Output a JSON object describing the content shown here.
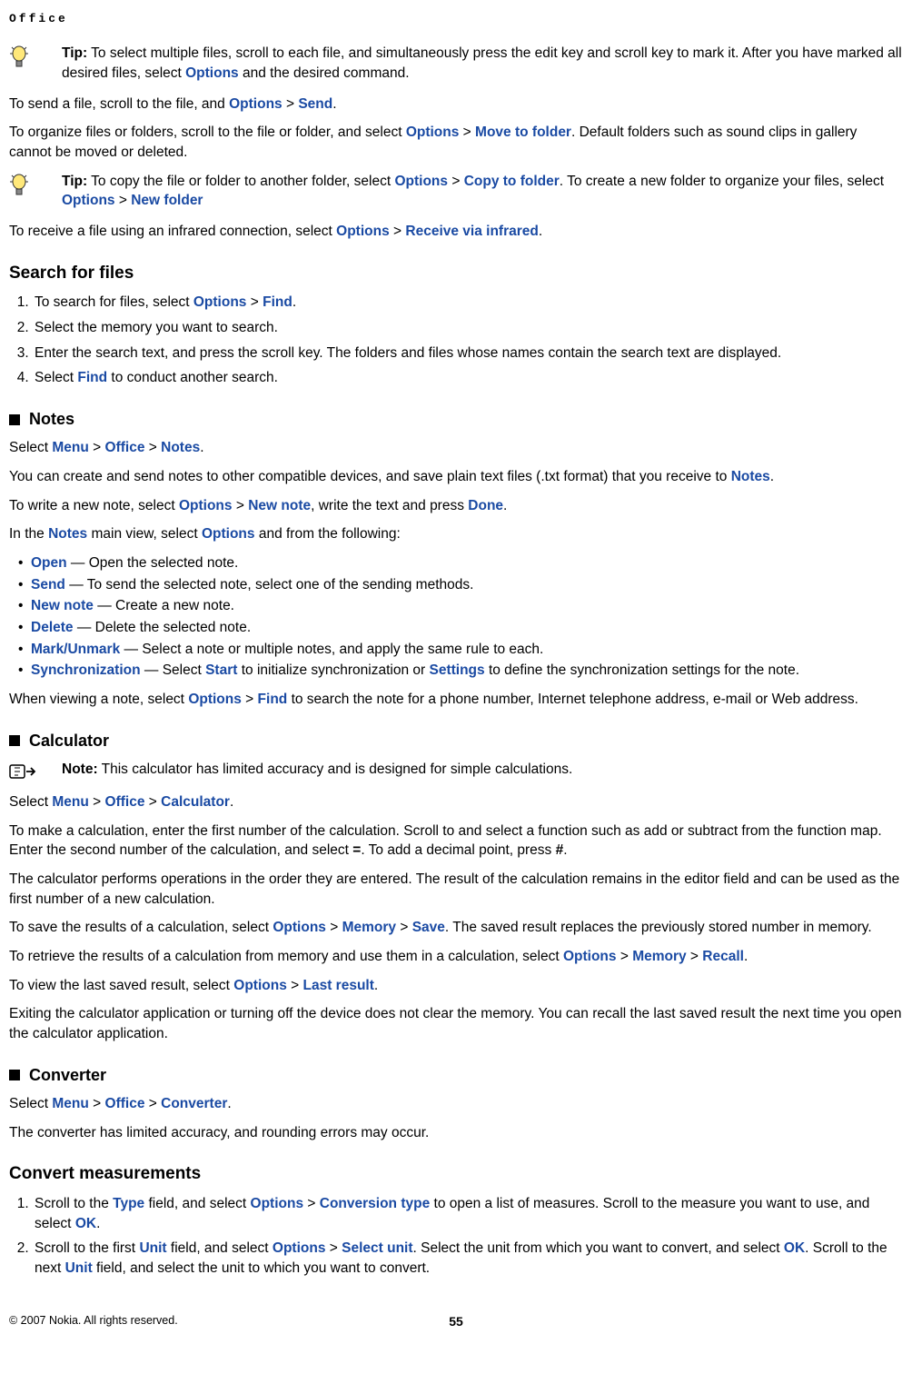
{
  "header": "Office",
  "tip1": {
    "label": "Tip:",
    "text1": " To select multiple files, scroll to each file, and simultaneously press the edit key and scroll key to mark it. After you have marked all desired files, select ",
    "options": "Options",
    "text2": " and the desired command."
  },
  "p1": {
    "t1": "To send a file, scroll to the file, and ",
    "options": "Options",
    "gt": " > ",
    "send": "Send",
    "t2": "."
  },
  "p2": {
    "t1": "To organize files or folders, scroll to the file or folder, and select ",
    "options": "Options",
    "gt": " > ",
    "move": "Move to folder",
    "t2": ". Default folders such as sound clips in gallery cannot be moved or deleted."
  },
  "tip2": {
    "label": "Tip:",
    "t1": " To copy the file or folder to another folder, select ",
    "options": "Options",
    "gt": " > ",
    "copy": "Copy to folder",
    "t2": ". To create a new folder to organize your files, select ",
    "options2": "Options",
    "gt2": " > ",
    "newfolder": "New folder"
  },
  "p3": {
    "t1": "To receive a file using an infrared connection, select ",
    "options": "Options",
    "gt": " > ",
    "receive": "Receive via infrared",
    "t2": "."
  },
  "search": {
    "title": "Search for files",
    "li1a": "To search for files, select ",
    "li1b": "Options",
    "li1c": " > ",
    "li1d": "Find",
    "li1e": ".",
    "li2": "Select the memory you want to search.",
    "li3": "Enter the search text, and press the scroll key. The folders and files whose names contain the search text are displayed.",
    "li4a": "Select ",
    "li4b": "Find",
    "li4c": " to conduct another search."
  },
  "notes": {
    "title": "Notes",
    "p1a": "Select ",
    "p1b": "Menu",
    "p1c": " > ",
    "p1d": "Office",
    "p1e": " > ",
    "p1f": "Notes",
    "p1g": ".",
    "p2a": "You can create and send notes to other compatible devices, and save plain text files (.txt format) that you receive to ",
    "p2b": "Notes",
    "p2c": ".",
    "p3a": "To write a new note, select ",
    "p3b": "Options",
    "p3c": " > ",
    "p3d": "New note",
    "p3e": ", write the text and press ",
    "p3f": "Done",
    "p3g": ".",
    "p4a": "In the ",
    "p4b": "Notes",
    "p4c": " main view, select ",
    "p4d": "Options",
    "p4e": " and from the following:",
    "bul1a": "Open",
    "bul1b": " — Open the selected note.",
    "bul2a": "Send",
    "bul2b": " — To send the selected note, select one of the sending methods.",
    "bul3a": "New note",
    "bul3b": " — Create a new note.",
    "bul4a": "Delete",
    "bul4b": " — Delete the selected note.",
    "bul5a": "Mark/Unmark",
    "bul5b": " — Select a note or multiple notes, and apply the same rule to each.",
    "bul6a": "Synchronization",
    "bul6b": " —  Select ",
    "bul6c": "Start",
    "bul6d": " to initialize synchronization or ",
    "bul6e": "Settings",
    "bul6f": " to define the synchronization settings for the note.",
    "p5a": "When viewing a note, select ",
    "p5b": "Options",
    "p5c": " > ",
    "p5d": "Find",
    "p5e": " to search the note for a phone number, Internet telephone address, e-mail or Web address."
  },
  "calc": {
    "title": "Calculator",
    "noteLabel": "Note:",
    "noteText": "  This calculator has limited accuracy and is designed for simple calculations.",
    "p1a": "Select ",
    "p1b": "Menu",
    "p1c": " > ",
    "p1d": "Office",
    "p1e": " > ",
    "p1f": "Calculator",
    "p1g": ".",
    "p2a": "To make a calculation, enter the first number of the calculation. Scroll to and select a function such as add or subtract from the function map. Enter the second number of the calculation, and select ",
    "p2b": "=",
    "p2c": ". To add a decimal point, press ",
    "p2d": "#",
    "p2e": ".",
    "p3": "The calculator performs operations in the order they are entered. The result of the calculation remains in the editor field and can be used as the first number of a new calculation.",
    "p4a": "To save the results of a calculation, select ",
    "p4b": "Options",
    "p4c": " > ",
    "p4d": "Memory",
    "p4e": " > ",
    "p4f": "Save",
    "p4g": ". The saved result replaces the previously stored number in memory.",
    "p5a": "To retrieve the results of a calculation from memory and use them in a calculation, select ",
    "p5b": "Options",
    "p5c": " > ",
    "p5d": "Memory",
    "p5e": " > ",
    "p5f": "Recall",
    "p5g": ".",
    "p6a": "To view the last saved result, select ",
    "p6b": "Options",
    "p6c": " > ",
    "p6d": "Last result",
    "p6e": ".",
    "p7": "Exiting the calculator application or turning off the device does not clear the memory. You can recall the last saved result the next time you open the calculator application."
  },
  "conv": {
    "title": "Converter",
    "p1a": "Select ",
    "p1b": "Menu",
    "p1c": " > ",
    "p1d": "Office",
    "p1e": " > ",
    "p1f": "Converter",
    "p1g": ".",
    "p2": "The converter has limited accuracy, and rounding errors may occur."
  },
  "convmeas": {
    "title": "Convert measurements",
    "li1a": "Scroll to the ",
    "li1b": "Type",
    "li1c": " field, and select ",
    "li1d": "Options",
    "li1e": " > ",
    "li1f": "Conversion type",
    "li1g": " to open a list of measures. Scroll to the measure you want to use, and select ",
    "li1h": "OK",
    "li1i": ".",
    "li2a": "Scroll to the first ",
    "li2b": "Unit",
    "li2c": " field, and select ",
    "li2d": "Options",
    "li2e": " > ",
    "li2f": "Select unit",
    "li2g": ". Select the unit from which you want to convert, and select ",
    "li2h": "OK",
    "li2i": ". Scroll to the next ",
    "li2j": "Unit",
    "li2k": " field, and select the unit to which you want to convert."
  },
  "footer": {
    "copyright": "© 2007 Nokia. All rights reserved.",
    "page": "55"
  }
}
